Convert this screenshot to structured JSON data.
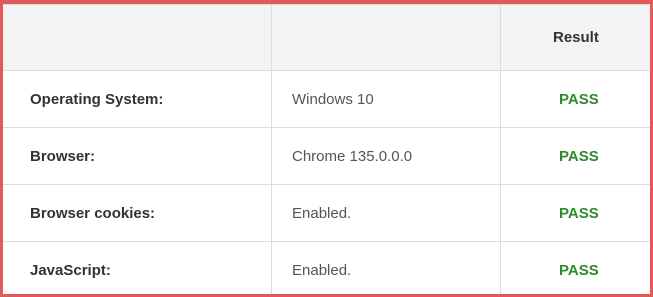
{
  "table": {
    "headers": [
      "",
      "",
      "Result"
    ],
    "rows": [
      {
        "label": "Operating System:",
        "value": "Windows 10",
        "result": "PASS"
      },
      {
        "label": "Browser:",
        "value": "Chrome 135.0.0.0",
        "result": "PASS"
      },
      {
        "label": "Browser cookies:",
        "value": "Enabled.",
        "result": "PASS"
      },
      {
        "label": "JavaScript:",
        "value": "Enabled.",
        "result": "PASS"
      }
    ]
  },
  "colors": {
    "highlight_border": "#e05a5a",
    "pass": "#2f8a2f",
    "header_bg": "#f3f3f3"
  }
}
